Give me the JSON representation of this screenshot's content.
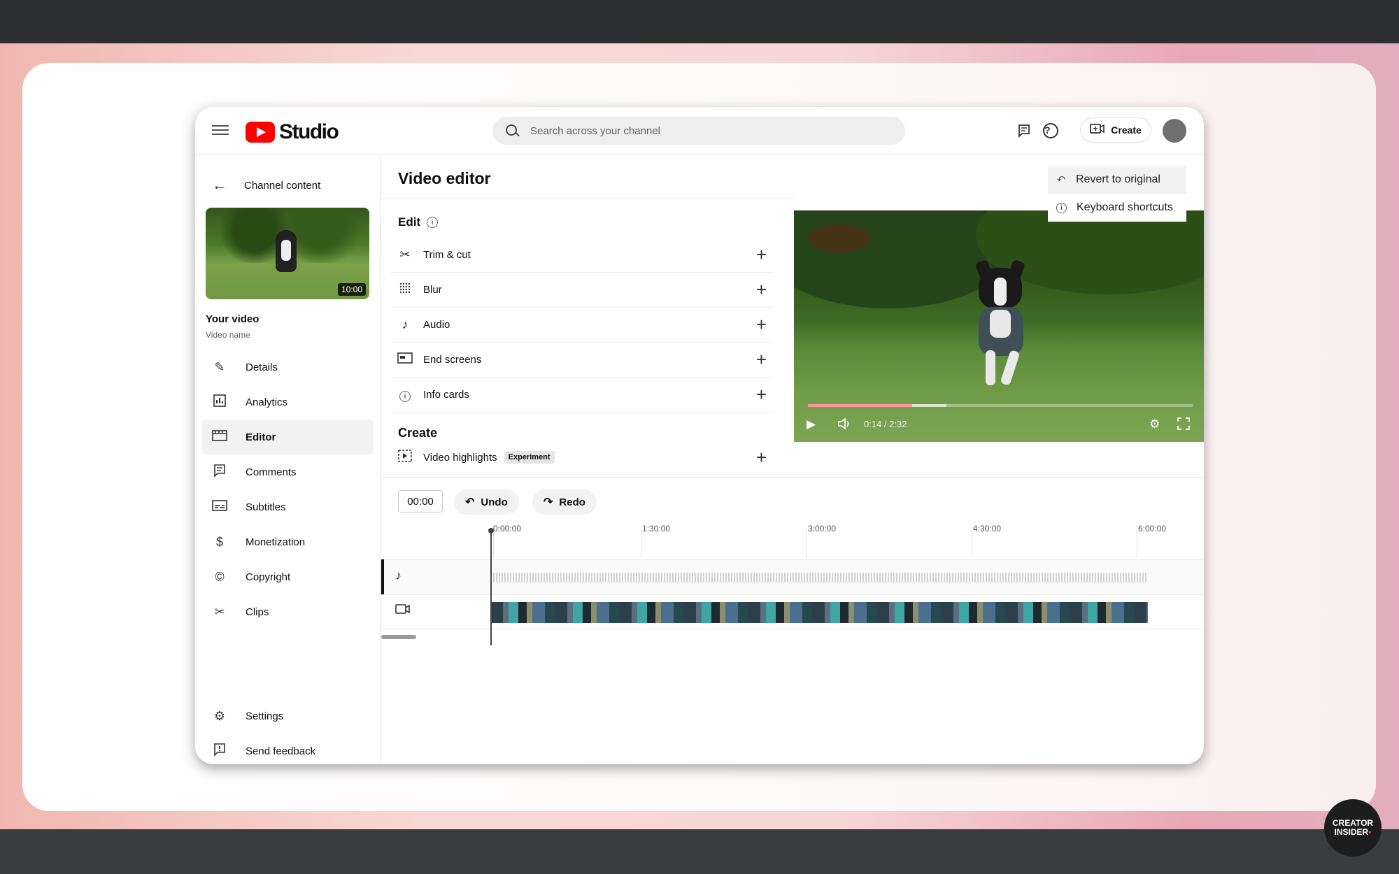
{
  "header": {
    "logo_text": "Studio",
    "search_placeholder": "Search across your channel",
    "create_label": "Create"
  },
  "sidebar": {
    "back_label": "Channel content",
    "thumbnail_duration": "10:00",
    "your_video_label": "Your video",
    "video_name": "Video name",
    "items": [
      {
        "label": "Details",
        "icon": "pencil-icon"
      },
      {
        "label": "Analytics",
        "icon": "analytics-icon"
      },
      {
        "label": "Editor",
        "icon": "editor-icon",
        "active": true
      },
      {
        "label": "Comments",
        "icon": "comments-icon"
      },
      {
        "label": "Subtitles",
        "icon": "subtitles-icon"
      },
      {
        "label": "Monetization",
        "icon": "dollar-icon"
      },
      {
        "label": "Copyright",
        "icon": "copyright-icon"
      },
      {
        "label": "Clips",
        "icon": "scissors-icon"
      }
    ],
    "bottom_items": [
      {
        "label": "Settings",
        "icon": "gear-icon"
      },
      {
        "label": "Send feedback",
        "icon": "feedback-icon"
      }
    ]
  },
  "editor": {
    "title": "Video editor",
    "edit_heading": "Edit",
    "tools": [
      {
        "label": "Trim & cut",
        "icon": "scissors-icon"
      },
      {
        "label": "Blur",
        "icon": "blur-grid-icon"
      },
      {
        "label": "Audio",
        "icon": "music-note-icon"
      },
      {
        "label": "End screens",
        "icon": "end-screen-icon"
      },
      {
        "label": "Info cards",
        "icon": "info-icon"
      }
    ],
    "create_heading": "Create",
    "highlights_label": "Video highlights",
    "highlights_badge": "Experiment"
  },
  "menu": {
    "revert_label": "Revert to original",
    "shortcuts_label": "Keyboard shortcuts"
  },
  "player": {
    "time": "0:14 / 2:32",
    "played_fraction": 0.27,
    "buffered_fraction": 0.36
  },
  "timeline": {
    "timecode": "00:00",
    "undo_label": "Undo",
    "redo_label": "Redo",
    "ruler": [
      "0:00:00",
      "1:30:00",
      "3:00:00",
      "4:30:00",
      "6:00:00"
    ]
  },
  "badge": {
    "line1": "CREATOR",
    "line2": "INSIDER"
  }
}
